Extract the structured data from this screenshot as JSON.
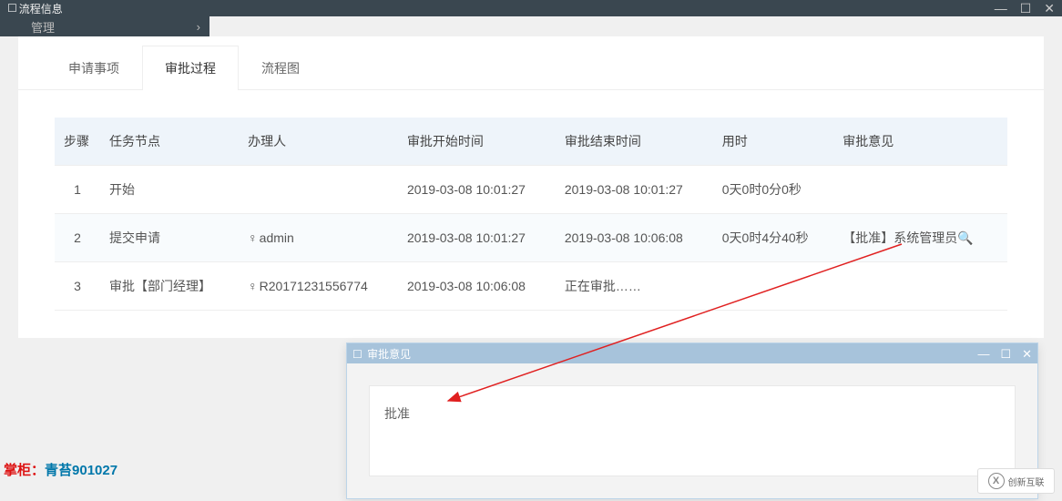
{
  "window": {
    "title": "流程信息",
    "min_icon": "—",
    "max_icon": "☐",
    "close_icon": "✕"
  },
  "sidebar": {
    "partial_item": "管理",
    "chevron": "›"
  },
  "tabs": [
    {
      "label": "申请事项"
    },
    {
      "label": "审批过程"
    },
    {
      "label": "流程图"
    }
  ],
  "active_tab_index": 1,
  "table": {
    "headers": [
      "步骤",
      "任务节点",
      "办理人",
      "审批开始时间",
      "审批结束时间",
      "用时",
      "审批意见"
    ],
    "rows": [
      {
        "step": "1",
        "node": "开始",
        "handler": "",
        "start": "2019-03-08 10:01:27",
        "end": "2019-03-08 10:01:27",
        "duration": "0天0时0分0秒",
        "opinion": ""
      },
      {
        "step": "2",
        "node": "提交申请",
        "handler_icon": "person-icon",
        "handler": "admin",
        "start": "2019-03-08 10:01:27",
        "end": "2019-03-08 10:06:08",
        "duration": "0天0时4分40秒",
        "opinion_icon": "search-icon",
        "opinion": "【批准】系统管理员"
      },
      {
        "step": "3",
        "node": "审批【部门经理】",
        "handler_icon": "person-icon",
        "handler": "R20171231556774",
        "start": "2019-03-08 10:06:08",
        "end": "正在审批……",
        "duration": "",
        "opinion": ""
      }
    ]
  },
  "sub_window": {
    "title": "审批意见",
    "content": "批准",
    "min_icon": "—",
    "max_icon": "☐",
    "close_icon": "✕"
  },
  "author": {
    "label": "掌柜：",
    "value": "青苔901027"
  },
  "watermark": "创新互联",
  "icons": {
    "person": "♀",
    "search": "🔍",
    "window": "☐"
  }
}
